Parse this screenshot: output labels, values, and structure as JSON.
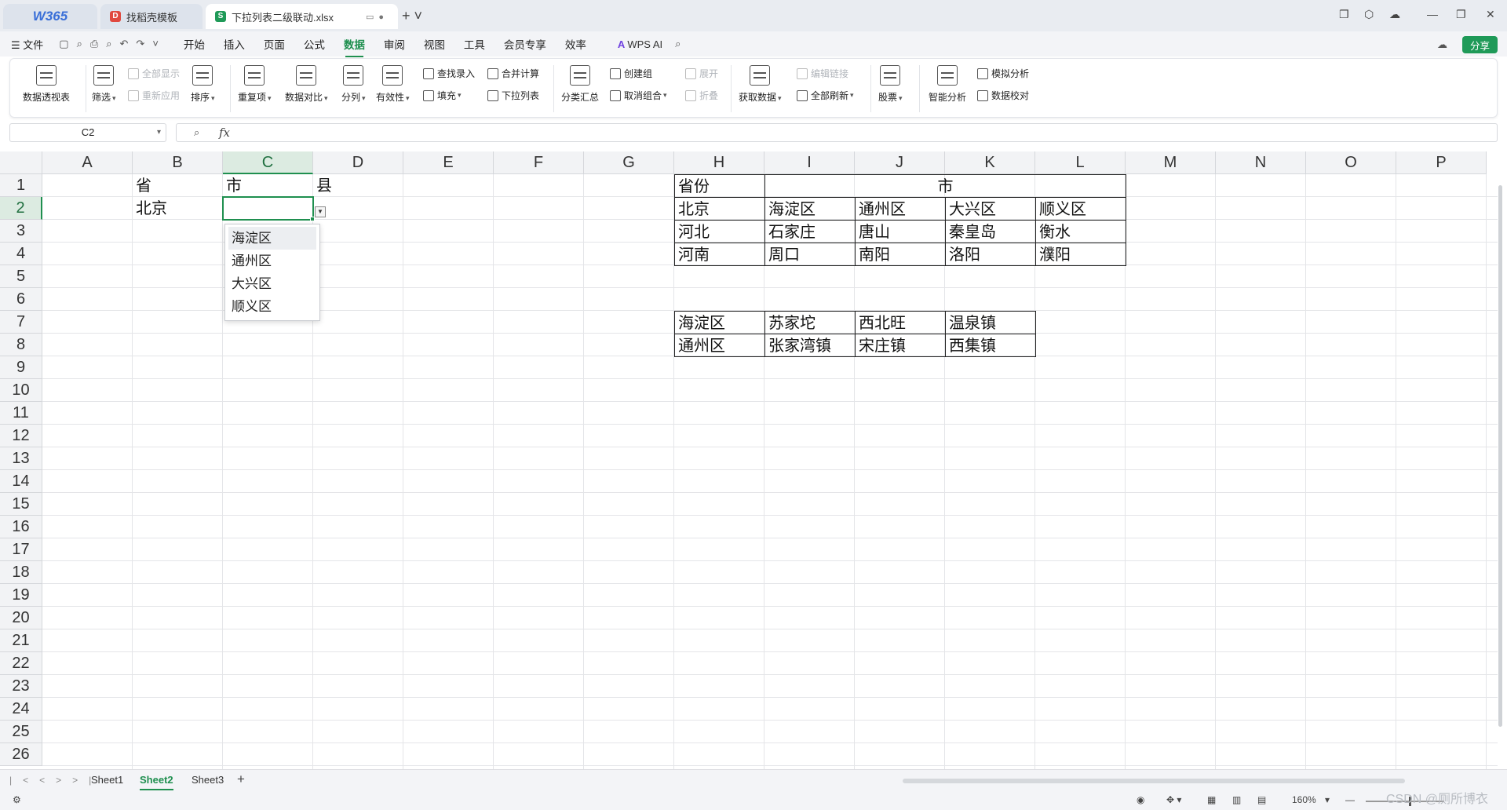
{
  "tabs": {
    "brand": "W365",
    "tab1": "找稻壳模板",
    "tab2": "下拉列表二级联动.xlsx"
  },
  "menubar": {
    "file": "文件",
    "items": [
      "开始",
      "插入",
      "页面",
      "公式",
      "数据",
      "审阅",
      "视图",
      "工具",
      "会员专享",
      "效率"
    ],
    "active": "数据",
    "ai": "WPS AI",
    "share": "分享"
  },
  "ribbon": {
    "pivot": "数据透视表",
    "filter": "筛选",
    "show_all": "全部显示",
    "reapply": "重新应用",
    "sort": "排序",
    "duplicates": "重复项",
    "compare": "数据对比",
    "split": "分列",
    "validity": "有效性",
    "lookup_entry": "查找录入",
    "fill": "填充",
    "consolidate": "合并计算",
    "dropdown_list": "下拉列表",
    "subtotal": "分类汇总",
    "group": "创建组",
    "ungroup": "取消组合",
    "expand": "展开",
    "collapse": "折叠",
    "get_data": "获取数据",
    "edit_links": "编辑链接",
    "refresh_all": "全部刷新",
    "stocks": "股票",
    "smart_analysis": "智能分析",
    "what_if": "模拟分析",
    "data_check": "数据校对"
  },
  "formula_bar": {
    "name_box": "C2",
    "fx": "fx",
    "value": ""
  },
  "columns": [
    "A",
    "B",
    "C",
    "D",
    "E",
    "F",
    "G",
    "H",
    "I",
    "J",
    "K",
    "L",
    "M",
    "N",
    "O",
    "P"
  ],
  "rows": [
    "1",
    "2",
    "3",
    "4",
    "5",
    "6",
    "7",
    "8",
    "9",
    "10",
    "11",
    "12",
    "13",
    "14",
    "15",
    "16",
    "17",
    "18",
    "19",
    "20",
    "21",
    "22",
    "23",
    "24",
    "25",
    "26"
  ],
  "selected_cell": {
    "col": "C",
    "row": "2"
  },
  "cells": {
    "B1": "省",
    "C1": "市",
    "D1": "县",
    "B2": "北京",
    "H1": "省份",
    "I1_merged": "市",
    "H2": "北京",
    "I2": "海淀区",
    "J2": "通州区",
    "K2": "大兴区",
    "L2": "顺义区",
    "H3": "河北",
    "I3": "石家庄",
    "J3": "唐山",
    "K3": "秦皇岛",
    "L3": "衡水",
    "H4": "河南",
    "I4": "周口",
    "J4": "南阳",
    "K4": "洛阳",
    "L4": "濮阳",
    "H7": "海淀区",
    "I7": "苏家坨",
    "J7": "西北旺",
    "K7": "温泉镇",
    "H8": "通州区",
    "I8": "张家湾镇",
    "J8": "宋庄镇",
    "K8": "西集镇"
  },
  "dropdown": {
    "items": [
      "海淀区",
      "通州区",
      "大兴区",
      "顺义区"
    ]
  },
  "sheets": {
    "names": [
      "Sheet1",
      "Sheet2",
      "Sheet3"
    ],
    "active": "Sheet2"
  },
  "status": {
    "zoom": "160%"
  },
  "watermark": "CSDN @厕所博衣"
}
